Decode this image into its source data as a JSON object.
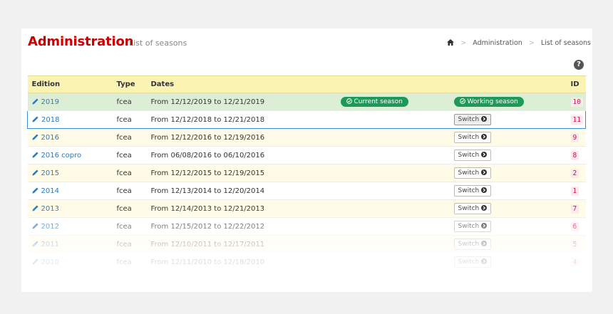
{
  "header": {
    "title": "Administration",
    "subtitle": "List of seasons",
    "breadcrumb": [
      "Administration",
      "List of seasons"
    ]
  },
  "icons": {
    "home": "home-icon",
    "help": "help-icon",
    "edit": "pencil-icon",
    "switch": "arrow-circle-right-icon",
    "check": "check-circle-icon"
  },
  "colors": {
    "title": "#cc0000",
    "badge_green": "#1e9a58",
    "link": "#2a7ac0",
    "header_bg": "#faf3b1",
    "current_row": "#dcefd6",
    "id_color": "#c8144a"
  },
  "table": {
    "columns": [
      "Edition",
      "Type",
      "Dates",
      "",
      "",
      "ID"
    ],
    "current_badge": "Current season",
    "working_badge": "Working season",
    "switch_label": "Switch",
    "rows": [
      {
        "edition": "2019",
        "type": "fcea",
        "dates": "From 12/12/2019 to 12/21/2019",
        "id": "10"
      },
      {
        "edition": "2018",
        "type": "fcea",
        "dates": "From 12/12/2018 to 12/21/2018",
        "id": "11"
      },
      {
        "edition": "2016",
        "type": "fcea",
        "dates": "From 12/12/2016 to 12/19/2016",
        "id": "9"
      },
      {
        "edition": "2016 copro",
        "type": "fcea",
        "dates": "From 06/08/2016 to 06/10/2016",
        "id": "8"
      },
      {
        "edition": "2015",
        "type": "fcea",
        "dates": "From 12/12/2015 to 12/19/2015",
        "id": "2"
      },
      {
        "edition": "2014",
        "type": "fcea",
        "dates": "From 12/13/2014 to 12/20/2014",
        "id": "1"
      },
      {
        "edition": "2013",
        "type": "fcea",
        "dates": "From 12/14/2013 to 12/21/2013",
        "id": "7"
      },
      {
        "edition": "2012",
        "type": "fcea",
        "dates": "From 12/15/2012 to 12/22/2012",
        "id": "6"
      },
      {
        "edition": "2011",
        "type": "fcea",
        "dates": "From 12/10/2011 to 12/17/2011",
        "id": "5"
      },
      {
        "edition": "2010",
        "type": "fcea",
        "dates": "From 12/11/2010 to 12/18/2010",
        "id": "4"
      }
    ]
  }
}
